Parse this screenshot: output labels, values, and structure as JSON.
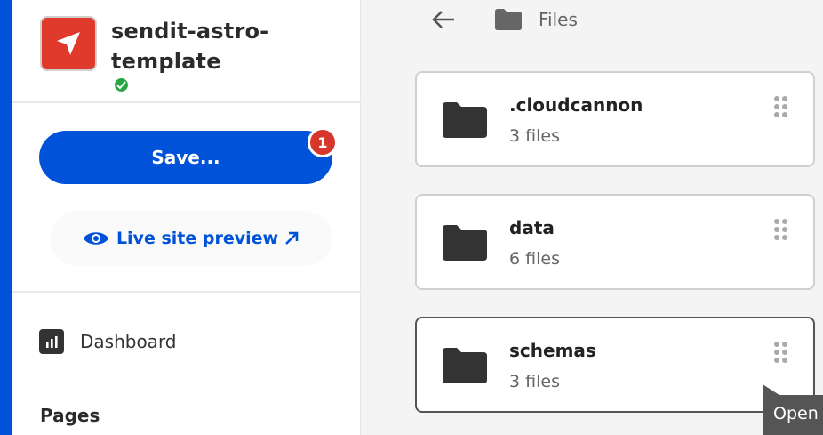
{
  "site": {
    "name": "sendit-astro-template",
    "logo_icon": "paper-plane-icon",
    "status_icon": "check-icon",
    "colors": {
      "brand": "#e03a2c",
      "status": "#28a745"
    }
  },
  "actions": {
    "save_label": "Save...",
    "save_badge": "1",
    "preview_label": "Live site preview",
    "preview_icon": "eye-icon",
    "external_icon": "external-link-icon"
  },
  "nav": {
    "dashboard": {
      "label": "Dashboard",
      "icon": "chart-icon"
    },
    "section_pages": "Pages"
  },
  "breadcrumb": {
    "back_icon": "arrow-left-icon",
    "folder_icon": "folder-icon",
    "label": "Files"
  },
  "folders": [
    {
      "name": ".cloudcannon",
      "count": "3 files"
    },
    {
      "name": "data",
      "count": "6 files"
    },
    {
      "name": "schemas",
      "count": "3 files"
    }
  ],
  "tooltip": {
    "text": "Open"
  },
  "colors": {
    "accent": "#0052d9",
    "badge": "#d7372b",
    "text": "#222222",
    "muted": "#666666"
  }
}
